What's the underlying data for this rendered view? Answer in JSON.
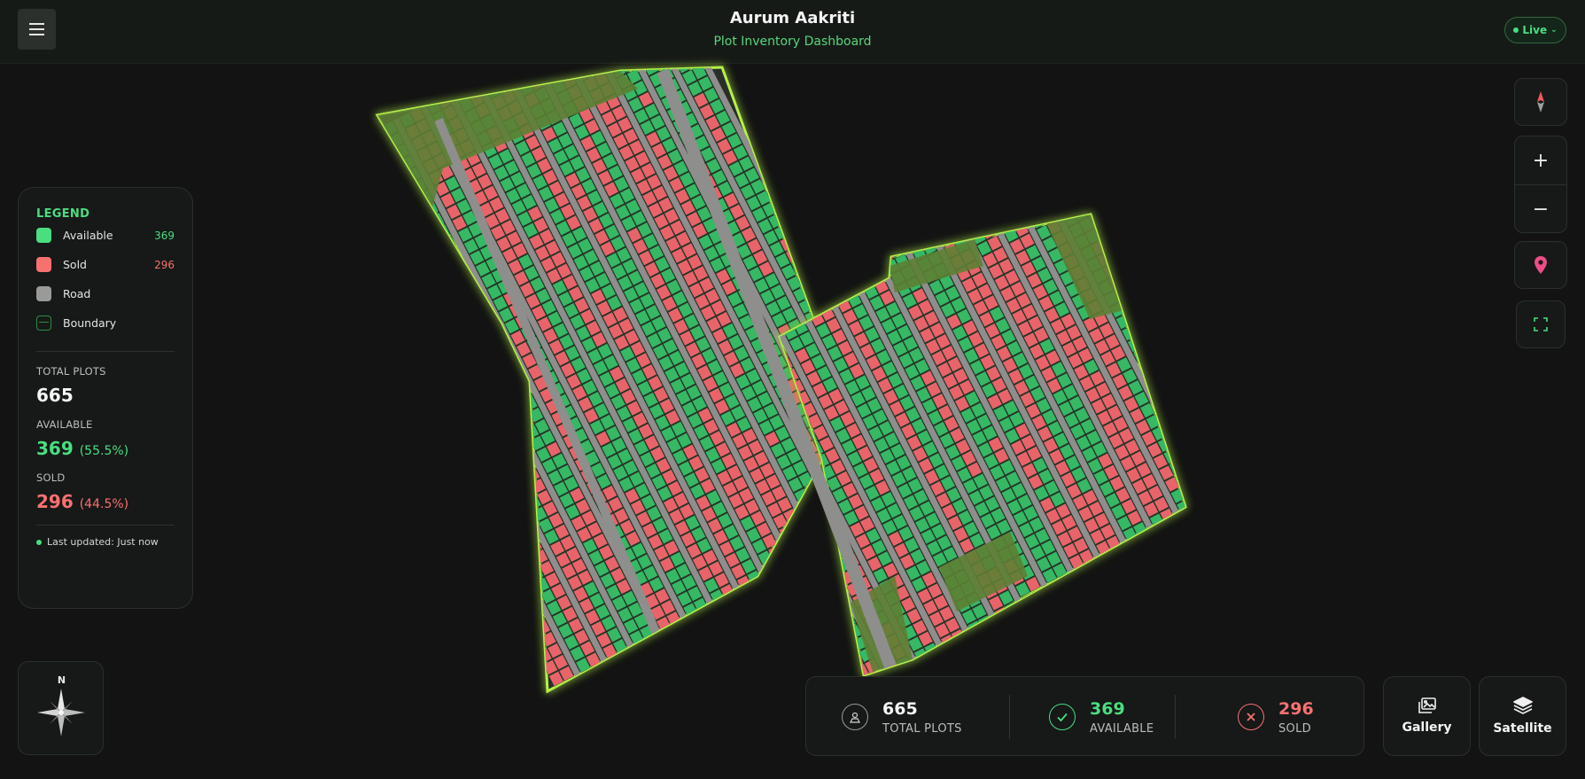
{
  "header": {
    "title": "Aurum Aakriti",
    "subtitle": "Plot Inventory Dashboard",
    "live_label": "Live"
  },
  "legend": {
    "heading": "LEGEND",
    "items": [
      {
        "label": "Available",
        "count": "369",
        "color": "#4ade80"
      },
      {
        "label": "Sold",
        "count": "296",
        "color": "#f87171"
      },
      {
        "label": "Road",
        "count": "",
        "color": "#9a9a98"
      },
      {
        "label": "Boundary",
        "count": "",
        "color": "#2e8b45"
      }
    ],
    "total_label": "TOTAL PLOTS",
    "total_value": "665",
    "available_label": "AVAILABLE",
    "available_value": "369",
    "available_pct": "(55.5%)",
    "sold_label": "SOLD",
    "sold_value": "296",
    "sold_pct": "(44.5%)",
    "updated_text": "Last updated: Just now"
  },
  "compass": {
    "north_label": "N"
  },
  "stats_bar": {
    "total_value": "665",
    "total_label": "TOTAL PLOTS",
    "available_value": "369",
    "available_label": "AVAILABLE",
    "sold_value": "296",
    "sold_label": "SOLD"
  },
  "buttons": {
    "gallery_label": "Gallery",
    "satellite_label": "Satellite"
  },
  "colors": {
    "accent": "#4ade80",
    "sold": "#f87171",
    "available_plot": "#36b865",
    "sold_plot": "#e8646a",
    "road": "#8e8e8c",
    "boundary_glow": "#b6f04a",
    "greenery": "#6f8f3a"
  },
  "icons": {
    "menu": "hamburger-icon",
    "compass_control": "north-arrow-icon",
    "zoom_in": "plus-icon",
    "zoom_out": "minus-icon",
    "location": "map-pin-icon",
    "fullscreen": "fullscreen-icon",
    "gallery": "image-icon",
    "satellite": "layers-icon"
  }
}
